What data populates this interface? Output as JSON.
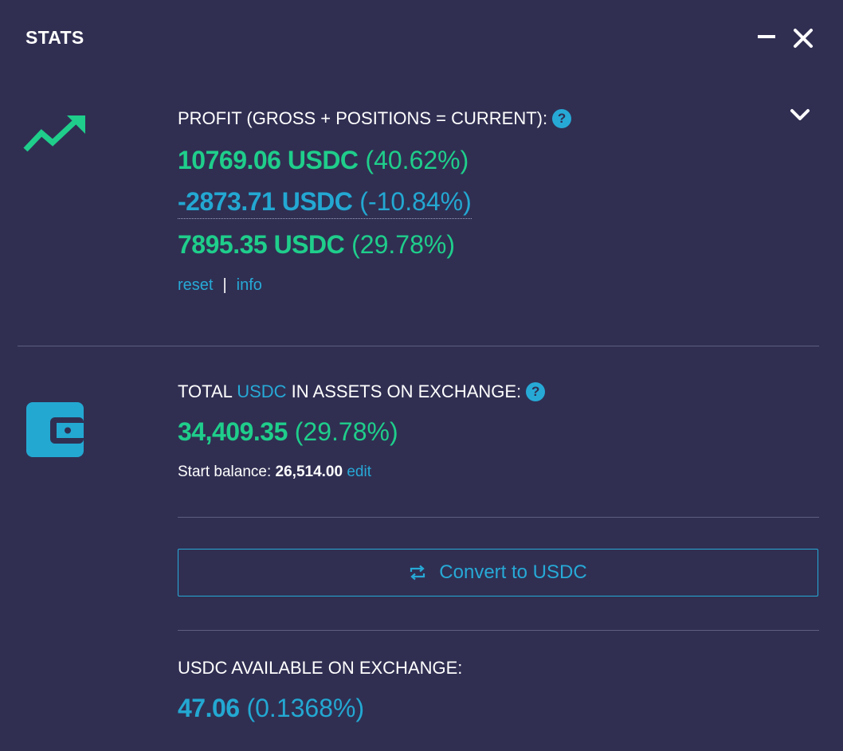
{
  "header": {
    "title": "STATS"
  },
  "profit": {
    "label": "PROFIT (GROSS + POSITIONS = CURRENT):",
    "help": "?",
    "gross_amount": "10769.06 USDC",
    "gross_percent": "(40.62%)",
    "positions_amount": "-2873.71 USDC",
    "positions_percent": "(-10.84%)",
    "current_amount": "7895.35 USDC",
    "current_percent": "(29.78%)",
    "reset_label": "reset",
    "separator": "|",
    "info_label": "info"
  },
  "assets": {
    "label_prefix": "TOTAL",
    "label_currency": "USDC",
    "label_suffix": "IN ASSETS ON EXCHANGE:",
    "help": "?",
    "total_amount": "34,409.35",
    "total_percent": "(29.78%)",
    "start_balance_label": "Start balance:",
    "start_balance_value": "26,514.00",
    "edit_label": "edit"
  },
  "convert": {
    "label": "Convert to USDC"
  },
  "available": {
    "label": "USDC AVAILABLE ON EXCHANGE:",
    "amount": "47.06",
    "percent": "(0.1368%)"
  },
  "colors": {
    "background": "#302f52",
    "green": "#1fce8b",
    "accent": "#27a9d6"
  },
  "icons": [
    "trend-up-icon",
    "wallet-icon",
    "help-icon",
    "chevron-down-icon",
    "minimize-icon",
    "close-icon",
    "swap-icon"
  ]
}
